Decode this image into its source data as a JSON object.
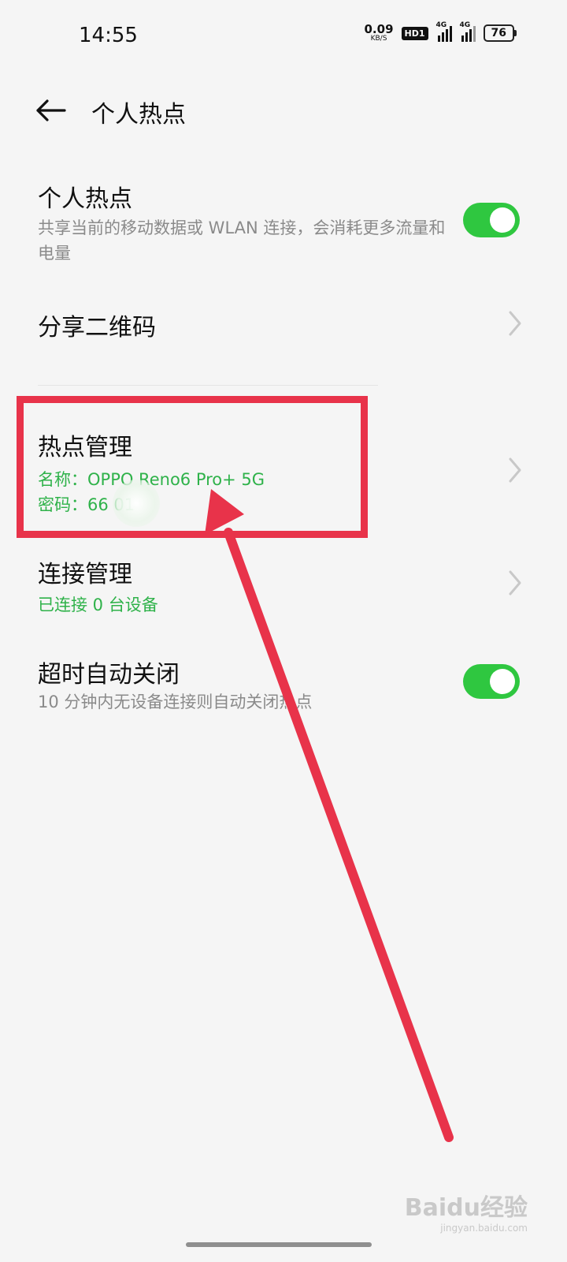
{
  "status_bar": {
    "time": "14:55",
    "net_speed_value": "0.09",
    "net_speed_unit": "KB/S",
    "hd_label": "HD1",
    "signal1_label": "4G",
    "signal2_label": "4G",
    "battery": "76"
  },
  "header": {
    "title": "个人热点"
  },
  "settings": {
    "hotspot": {
      "title": "个人热点",
      "description": "共享当前的移动数据或 WLAN 连接，会消耗更多流量和电量",
      "enabled": true
    },
    "share_qr": {
      "title": "分享二维码"
    },
    "hotspot_management": {
      "title": "热点管理",
      "name_line": "名称：OPPO Reno6 Pro+ 5G",
      "password_line": "密码：66      01"
    },
    "connection_management": {
      "title": "连接管理",
      "status": "已连接 0 台设备"
    },
    "auto_off": {
      "title": "超时自动关闭",
      "description": "10 分钟内无设备连接则自动关闭热点",
      "enabled": true
    }
  },
  "annotation": {
    "highlight_color": "#e8334a"
  },
  "colors": {
    "accent_green": "#2fc740",
    "text_green": "#2fb24a",
    "background": "#f5f5f5"
  },
  "watermark": {
    "logo": "Baidu经验",
    "url": "jingyan.baidu.com"
  }
}
